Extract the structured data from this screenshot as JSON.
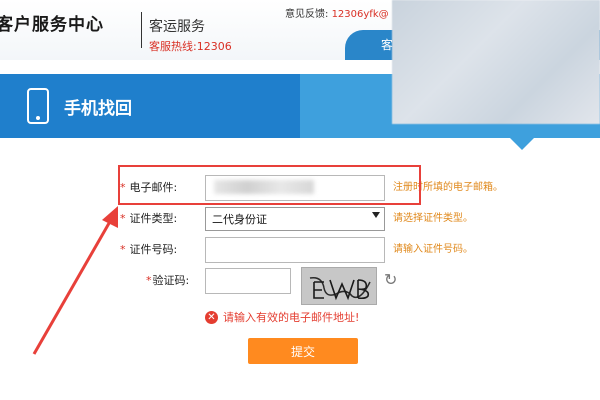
{
  "header": {
    "logo_title": "客户服务中心",
    "logo_sub": "客运服务",
    "hotline": "客服热线:12306",
    "feedback_label": "意见反馈:",
    "feedback_email": "12306yfk@",
    "nav_tab": "客"
  },
  "band": {
    "title": "手机找回",
    "icon": "mobile-phone-icon"
  },
  "form": {
    "email": {
      "label": "电子邮件:",
      "value": "",
      "hint": "注册时所填的电子邮箱。"
    },
    "id_type": {
      "label": "证件类型:",
      "selected": "二代身份证",
      "hint": "请选择证件类型。"
    },
    "id_number": {
      "label": "证件号码:",
      "value": "",
      "hint": "请输入证件号码。"
    },
    "captcha": {
      "label": "验证码:",
      "value": "",
      "image_text": "EWB",
      "refresh_icon": "refresh-icon"
    },
    "error": {
      "icon": "error-icon",
      "text": "请输入有效的电子邮件地址!"
    },
    "submit_label": "提交"
  },
  "colors": {
    "primary_blue": "#1f7fcc",
    "band_blue": "#3ea0dd",
    "submit_orange": "#ff8a1f",
    "hint_orange": "#e0891c",
    "error_red": "#e43d30",
    "annotation_red": "#e8403a"
  }
}
